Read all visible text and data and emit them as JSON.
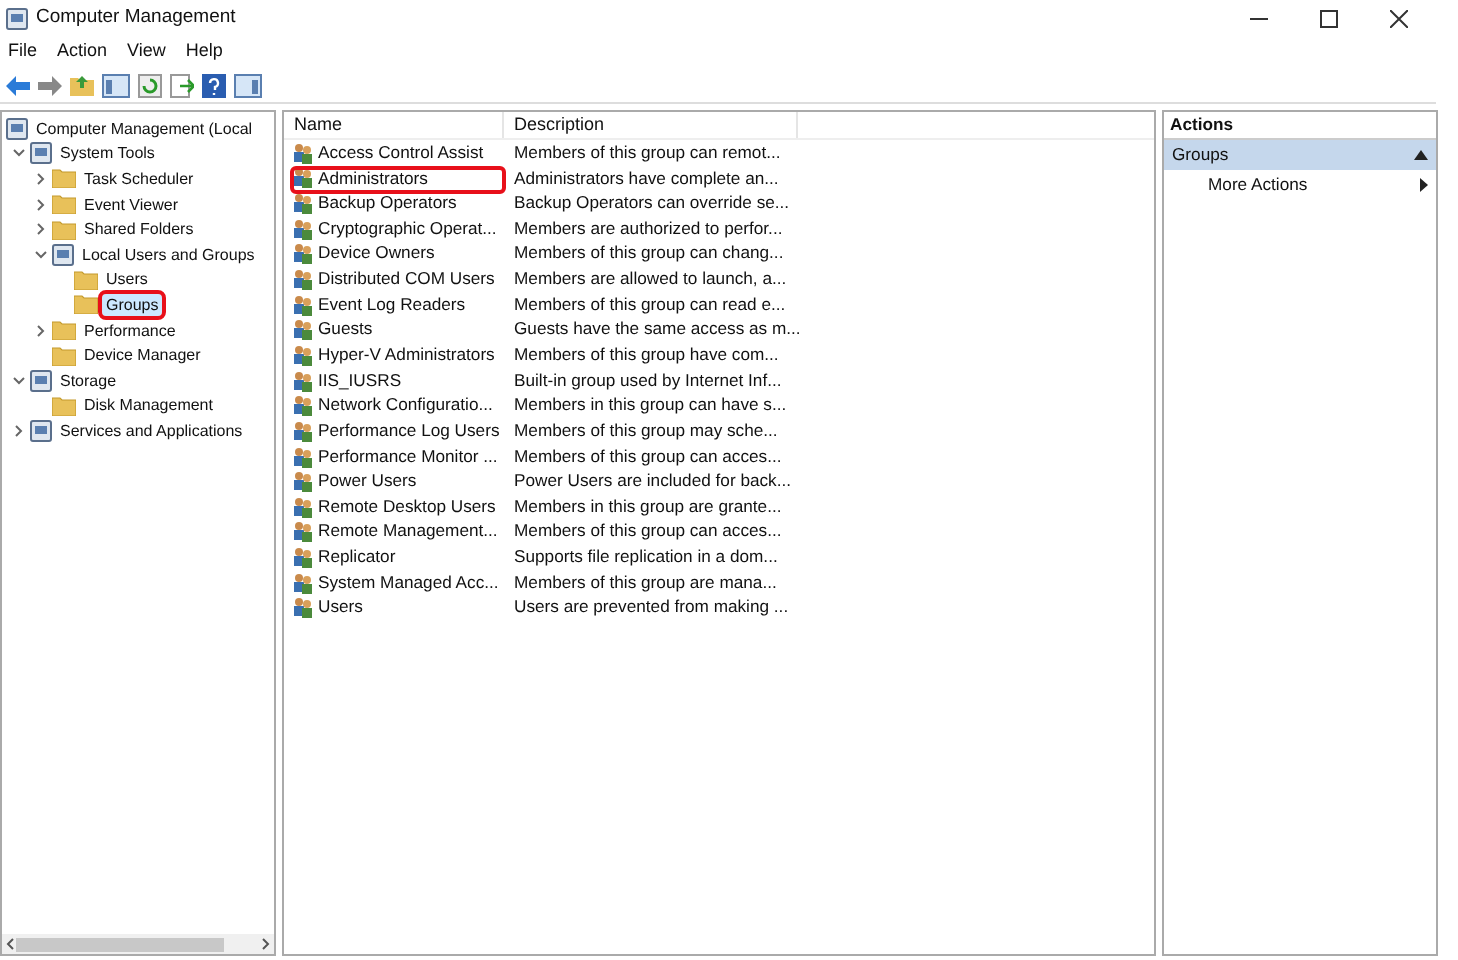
{
  "window": {
    "title": "Computer Management"
  },
  "menu": [
    "File",
    "Action",
    "View",
    "Help"
  ],
  "tree": [
    {
      "label": "Computer Management (Local",
      "selected": false,
      "children": [
        {
          "label": "System Tools",
          "selected": false,
          "expanded": true,
          "children": [
            {
              "label": "Task Scheduler",
              "selected": false,
              "expanded": false
            },
            {
              "label": "Event Viewer",
              "selected": false,
              "expanded": false
            },
            {
              "label": "Shared Folders",
              "selected": false,
              "expanded": false
            },
            {
              "label": "Local Users and Groups",
              "selected": false,
              "expanded": true,
              "children": [
                {
                  "label": "Users",
                  "selected": false
                },
                {
                  "label": "Groups",
                  "selected": true
                }
              ]
            },
            {
              "label": "Performance",
              "selected": false,
              "expanded": false
            },
            {
              "label": "Device Manager",
              "selected": false
            }
          ]
        },
        {
          "label": "Storage",
          "selected": false,
          "expanded": true,
          "children": [
            {
              "label": "Disk Management",
              "selected": false
            }
          ]
        },
        {
          "label": "Services and Applications",
          "selected": false,
          "expanded": false
        }
      ]
    }
  ],
  "table": {
    "columns": [
      "Name",
      "Description"
    ],
    "rows": [
      {
        "name": "Access Control Assist",
        "description": "Members of this group can remot..."
      },
      {
        "name": "Administrators",
        "description": "Administrators have complete an..."
      },
      {
        "name": "Backup Operators",
        "description": "Backup Operators can override se..."
      },
      {
        "name": "Cryptographic Operat...",
        "description": "Members are authorized to perfor..."
      },
      {
        "name": "Device Owners",
        "description": "Members of this group can chang..."
      },
      {
        "name": "Distributed COM Users",
        "description": "Members are allowed to launch, a..."
      },
      {
        "name": "Event Log Readers",
        "description": "Members of this group can read e..."
      },
      {
        "name": "Guests",
        "description": "Guests have the same access as m..."
      },
      {
        "name": "Hyper-V Administrators",
        "description": "Members of this group have com..."
      },
      {
        "name": "IIS_IUSRS",
        "description": "Built-in group used by Internet Inf..."
      },
      {
        "name": "Network Configuratio...",
        "description": "Members in this group can have s..."
      },
      {
        "name": "Performance Log Users",
        "description": "Members of this group may sche..."
      },
      {
        "name": "Performance Monitor ...",
        "description": "Members of this group can acces..."
      },
      {
        "name": "Power Users",
        "description": "Power Users are included for back..."
      },
      {
        "name": "Remote Desktop Users",
        "description": "Members in this group are grante..."
      },
      {
        "name": "Remote Management...",
        "description": "Members of this group can acces..."
      },
      {
        "name": "Replicator",
        "description": "Supports file replication in a dom..."
      },
      {
        "name": "System Managed Acc...",
        "description": "Members of this group are mana..."
      },
      {
        "name": "Users",
        "description": "Users are prevented from making ..."
      }
    ]
  },
  "actions": {
    "title": "Actions",
    "section": {
      "label": "Groups",
      "expanded": true
    },
    "items": [
      "More Actions"
    ]
  }
}
